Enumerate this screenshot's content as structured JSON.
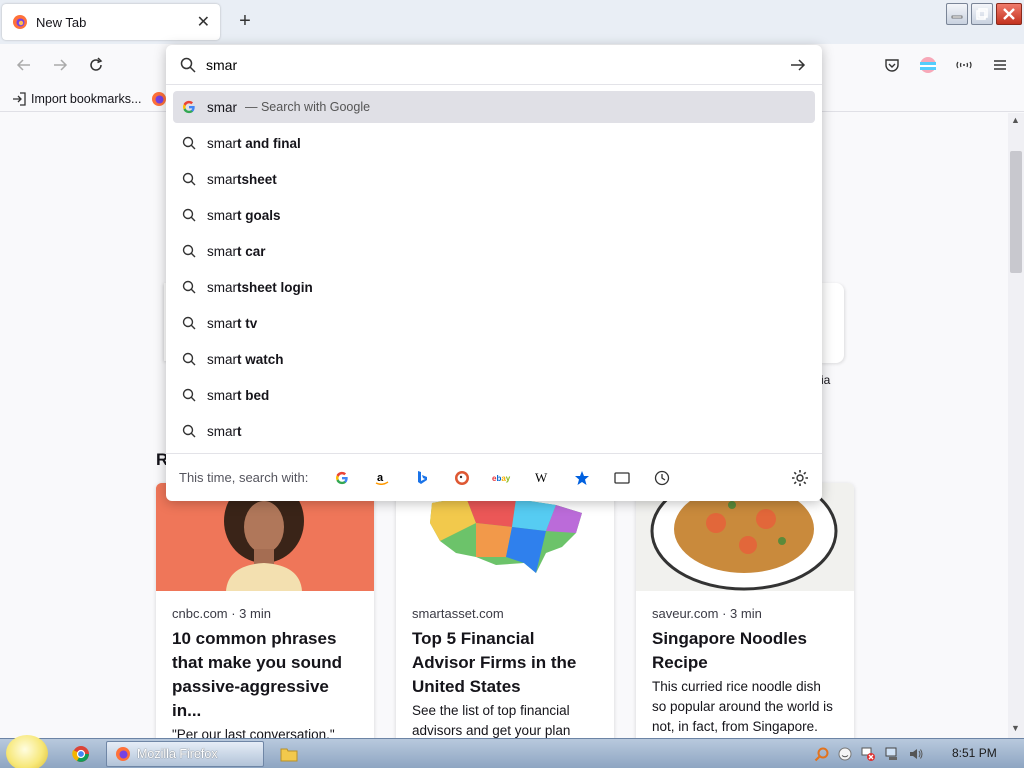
{
  "tab": {
    "title": "New Tab"
  },
  "bookmarks": {
    "import_label": "Import bookmarks..."
  },
  "urlbar": {
    "query": "smar"
  },
  "suggestions": [
    {
      "prefix": "smar",
      "bold": "",
      "suffix": "— Search with Google",
      "engine": "google",
      "highlighted": true
    },
    {
      "prefix": "smar",
      "bold": "t and final"
    },
    {
      "prefix": "smar",
      "bold": "tsheet"
    },
    {
      "prefix": "smar",
      "bold": "t goals"
    },
    {
      "prefix": "smar",
      "bold": "t car"
    },
    {
      "prefix": "smar",
      "bold": "tsheet login"
    },
    {
      "prefix": "smar",
      "bold": "t tv"
    },
    {
      "prefix": "smar",
      "bold": "t watch"
    },
    {
      "prefix": "smar",
      "bold": "t bed"
    },
    {
      "prefix": "smar",
      "bold": "t"
    }
  ],
  "search_with": {
    "label": "This time, search with:",
    "engines": [
      "google-icon",
      "amazon-icon",
      "bing-icon",
      "duckduckgo-icon",
      "ebay-icon",
      "wikipedia-icon",
      "bookmarks-icon",
      "tabs-icon",
      "history-icon"
    ]
  },
  "page": {
    "recent_heading_fragment": "R",
    "shortcut_label_fragment": "ia"
  },
  "cards": [
    {
      "source": "cnbc.com · 3 min",
      "headline": "10 common phrases that make you sound passive-aggressive in...",
      "excerpt": "\"Per our last conversation.\""
    },
    {
      "source": "smartasset.com",
      "headline": "Top 5 Financial Advisor Firms in the United States",
      "excerpt": "See the list of top financial advisors and get your plan"
    },
    {
      "source": "saveur.com · 3 min",
      "headline": "Singapore Noodles Recipe",
      "excerpt": "This curried rice noodle dish so popular around the world is not, in fact, from Singapore."
    }
  ],
  "taskbar": {
    "firefox_label": "Mozilla Firefox",
    "clock": "8:51 PM"
  },
  "colors": {
    "accent": "#0060df",
    "highlight_row": "#e0e0e6",
    "taskbar": "#9fb4cf"
  }
}
